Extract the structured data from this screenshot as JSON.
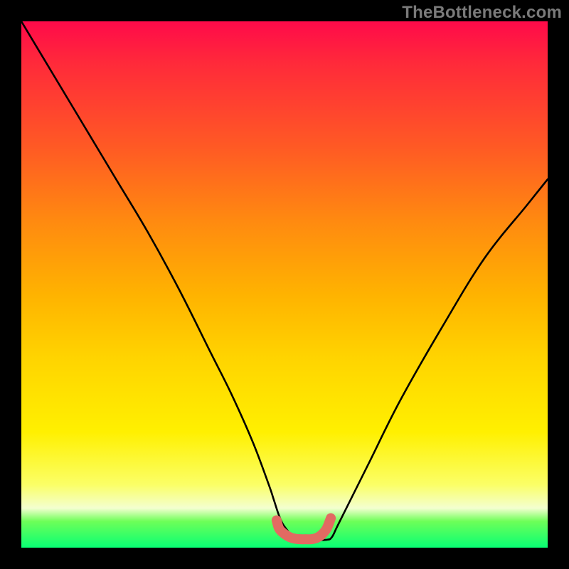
{
  "watermark": "TheBottleneck.com",
  "chart_data": {
    "type": "line",
    "title": "",
    "xlabel": "",
    "ylabel": "",
    "xlim": [
      0,
      100
    ],
    "ylim": [
      0,
      100
    ],
    "grid": false,
    "legend": false,
    "annotations": [],
    "series": [
      {
        "name": "bottleneck-curve",
        "color": "#000000",
        "x": [
          0,
          6,
          12,
          18,
          24,
          30,
          36,
          40,
          44,
          47,
          48,
          49,
          50,
          52,
          55,
          58,
          59,
          60,
          62,
          66,
          72,
          80,
          88,
          96,
          100
        ],
        "values": [
          100,
          90,
          80,
          70,
          60,
          49,
          37,
          29,
          20,
          12,
          9,
          6,
          4,
          2,
          1.5,
          1.5,
          2,
          4,
          8,
          16,
          28,
          42,
          55,
          65,
          70
        ]
      },
      {
        "name": "optimal-band",
        "color": "#e26a62",
        "x": [
          48.5,
          49,
          50,
          51,
          52,
          53,
          54,
          55,
          56,
          57,
          58,
          58.8
        ],
        "values": [
          5.2,
          3.6,
          2.6,
          2.0,
          1.7,
          1.6,
          1.6,
          1.6,
          1.8,
          2.4,
          3.6,
          5.6
        ]
      }
    ],
    "gradient_stops": [
      {
        "pos": 0.0,
        "color": "#ff0a4a"
      },
      {
        "pos": 0.08,
        "color": "#ff2a3a"
      },
      {
        "pos": 0.24,
        "color": "#ff5a24"
      },
      {
        "pos": 0.38,
        "color": "#ff8a10"
      },
      {
        "pos": 0.52,
        "color": "#ffb300"
      },
      {
        "pos": 0.64,
        "color": "#ffd400"
      },
      {
        "pos": 0.78,
        "color": "#fff000"
      },
      {
        "pos": 0.88,
        "color": "#fbff66"
      },
      {
        "pos": 0.925,
        "color": "#f3ffd0"
      },
      {
        "pos": 0.95,
        "color": "#6dff58"
      },
      {
        "pos": 1.0,
        "color": "#08ff74"
      }
    ]
  }
}
